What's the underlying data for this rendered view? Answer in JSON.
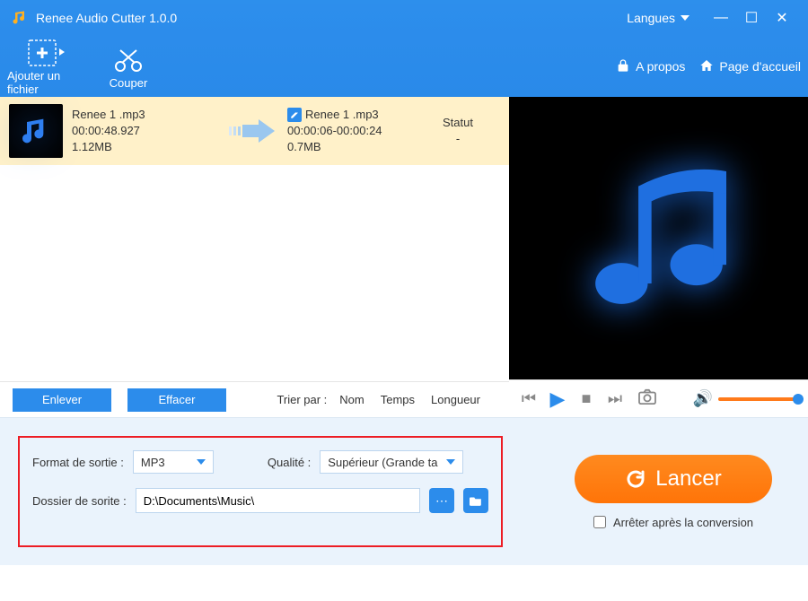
{
  "app": {
    "title": "Renee Audio Cutter 1.0.0"
  },
  "titlebar": {
    "lang_label": "Langues"
  },
  "toolbar": {
    "add_label": "Ajouter un fichier",
    "cut_label": "Couper",
    "about_label": "A propos",
    "home_label": "Page d'accueil"
  },
  "file": {
    "src_name": "Renee 1 .mp3",
    "src_duration": "00:00:48.927",
    "src_size": "1.12MB",
    "dst_name": "Renee 1 .mp3",
    "dst_range": "00:00:06-00:00:24",
    "dst_size": "0.7MB",
    "status_label": "Statut",
    "status_value": "-"
  },
  "listfooter": {
    "remove": "Enlever",
    "clear": "Effacer",
    "sort_label": "Trier par :",
    "sort_name": "Nom",
    "sort_time": "Temps",
    "sort_length": "Longueur"
  },
  "settings": {
    "format_label": "Format de sortie :",
    "format_value": "MP3",
    "quality_label": "Qualité :",
    "quality_value": "Supérieur (Grande ta",
    "folder_label": "Dossier de sorite :",
    "folder_value": "D:\\Documents\\Music\\"
  },
  "launch": {
    "button": "Lancer",
    "stop_after": "Arrêter après la conversion"
  },
  "colors": {
    "accent": "#2c8ceb",
    "orange": "#ff7a1a"
  }
}
